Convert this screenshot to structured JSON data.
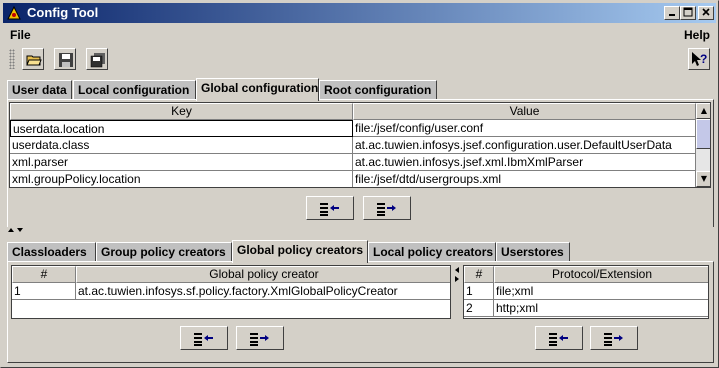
{
  "window": {
    "title": "Config Tool"
  },
  "menubar": {
    "file": "File",
    "help": "Help"
  },
  "toolbar": {
    "open_icon": "open-folder-icon",
    "save_icon": "save-disk-icon",
    "saveall_icon": "save-all-icon",
    "help_icon": "context-help-icon"
  },
  "top_tabs": [
    "User data",
    "Local configuration",
    "Global configuration",
    "Root configuration"
  ],
  "top_active": "Global configuration",
  "config_table": {
    "headers": [
      "Key",
      "Value"
    ],
    "rows": [
      [
        "userdata.location",
        "file:/jsef/config/user.conf"
      ],
      [
        "userdata.class",
        "at.ac.tuwien.infosys.jsef.configuration.user.DefaultUserData"
      ],
      [
        "xml.parser",
        "at.ac.tuwien.infosys.jsef.xml.IbmXmlParser"
      ],
      [
        "xml.groupPolicy.location",
        "file:/jsef/dtd/usergroups.xml"
      ]
    ]
  },
  "bottom_tabs": [
    "Classloaders",
    "Group policy creators",
    "Global policy creators",
    "Local policy creators",
    "Userstores"
  ],
  "bottom_active": "Global policy creators",
  "policy_table": {
    "headers": [
      "#",
      "Global policy creator"
    ],
    "rows": [
      [
        "1",
        "at.ac.tuwien.infosys.sf.policy.factory.XmlGlobalPolicyCreator"
      ]
    ]
  },
  "protocol_table": {
    "headers": [
      "#",
      "Protocol/Extension"
    ],
    "rows": [
      [
        "1",
        "file;xml"
      ],
      [
        "2",
        "http;xml"
      ]
    ]
  },
  "colors": {
    "titlebar_start": "#0a246a",
    "titlebar_end": "#a6caf0",
    "face": "#d4d0c8"
  }
}
